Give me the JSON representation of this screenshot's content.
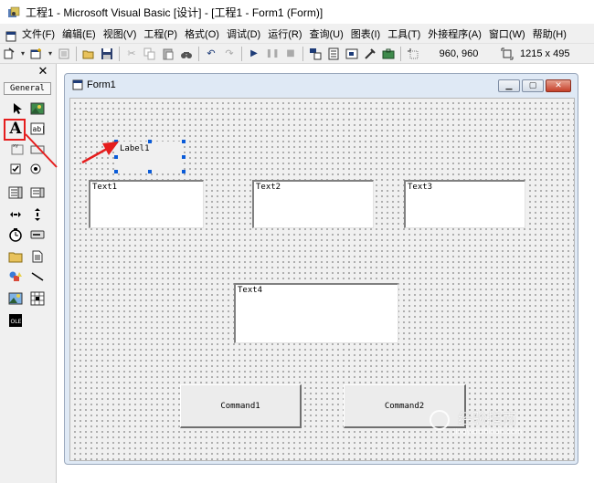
{
  "window": {
    "title": "工程1 - Microsoft Visual Basic [设计] - [工程1 - Form1 (Form)]"
  },
  "menu": [
    "文件(F)",
    "编辑(E)",
    "视图(V)",
    "工程(P)",
    "格式(O)",
    "调试(D)",
    "运行(R)",
    "查询(U)",
    "图表(I)",
    "工具(T)",
    "外接程序(A)",
    "窗口(W)",
    "帮助(H)"
  ],
  "toolbar": {
    "position": "960, 960",
    "size": "1215 x 495"
  },
  "toolbox": {
    "tab": "General",
    "close": "✕"
  },
  "form": {
    "title": "Form1",
    "controls": {
      "label1": "Label1",
      "text1": "Text1",
      "text2": "Text2",
      "text3": "Text3",
      "text4": "Text4",
      "command1": "Command1",
      "command2": "Command2"
    }
  },
  "watermark": {
    "main": "经验指南",
    "sub": "jingyanzhinan.com"
  },
  "colors": {
    "highlight": "#e51d1d",
    "selection_handle": "#0a5bd8"
  }
}
